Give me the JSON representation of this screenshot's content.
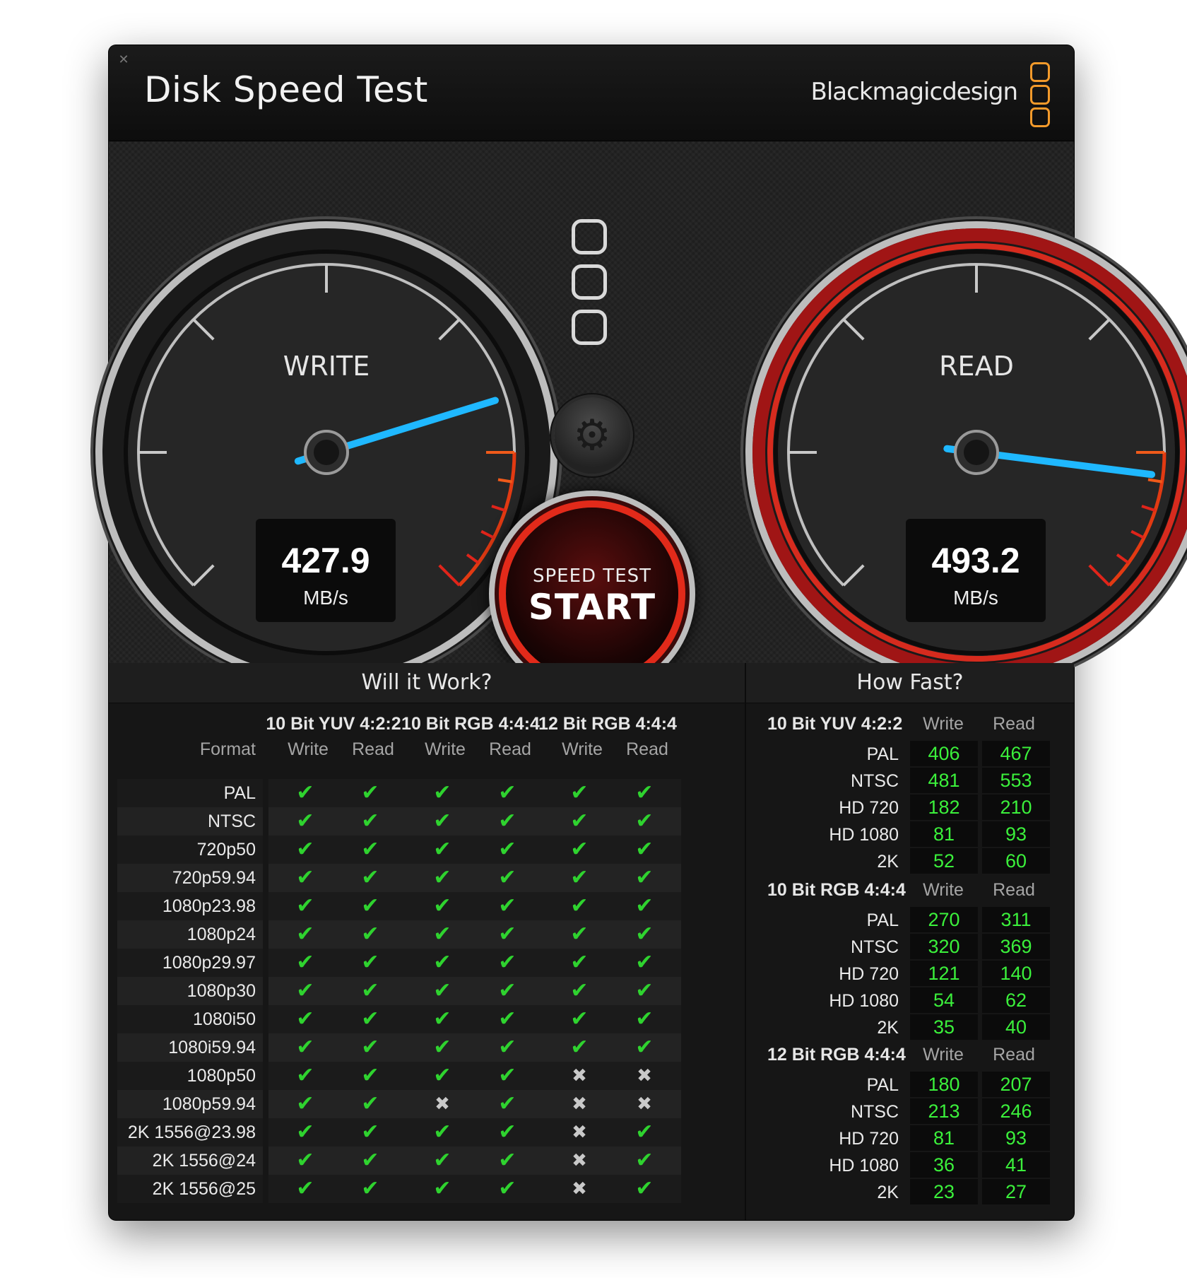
{
  "window": {
    "close_icon": "✕",
    "title": "Disk Speed Test",
    "brand": "Blackmagicdesign"
  },
  "colors": {
    "accent_orange": "#f39a2b",
    "needle_blue": "#1fb8ff",
    "start_red": "#e22a1a",
    "value_green": "#3bf03b",
    "check_green": "#2fd32f"
  },
  "gauges": {
    "write": {
      "label": "WRITE",
      "value": "427.9",
      "unit": "MB/s",
      "needle_fraction": 0.77
    },
    "read": {
      "label": "READ",
      "value": "493.2",
      "unit": "MB/s",
      "needle_fraction": 0.86
    }
  },
  "start_button": {
    "small": "SPEED TEST",
    "big": "START"
  },
  "settings_icon": "gear-icon",
  "will_it_work": {
    "title": "Will it Work?",
    "format_header": "Format",
    "groups": [
      "10 Bit YUV 4:2:2",
      "10 Bit RGB 4:4:4",
      "12 Bit RGB 4:4:4"
    ],
    "subheaders": [
      "Write",
      "Read",
      "Write",
      "Read",
      "Write",
      "Read"
    ],
    "rows": [
      {
        "format": "PAL",
        "cells": [
          1,
          1,
          1,
          1,
          1,
          1
        ]
      },
      {
        "format": "NTSC",
        "cells": [
          1,
          1,
          1,
          1,
          1,
          1
        ]
      },
      {
        "format": "720p50",
        "cells": [
          1,
          1,
          1,
          1,
          1,
          1
        ]
      },
      {
        "format": "720p59.94",
        "cells": [
          1,
          1,
          1,
          1,
          1,
          1
        ]
      },
      {
        "format": "1080p23.98",
        "cells": [
          1,
          1,
          1,
          1,
          1,
          1
        ]
      },
      {
        "format": "1080p24",
        "cells": [
          1,
          1,
          1,
          1,
          1,
          1
        ]
      },
      {
        "format": "1080p29.97",
        "cells": [
          1,
          1,
          1,
          1,
          1,
          1
        ]
      },
      {
        "format": "1080p30",
        "cells": [
          1,
          1,
          1,
          1,
          1,
          1
        ]
      },
      {
        "format": "1080i50",
        "cells": [
          1,
          1,
          1,
          1,
          1,
          1
        ]
      },
      {
        "format": "1080i59.94",
        "cells": [
          1,
          1,
          1,
          1,
          1,
          1
        ]
      },
      {
        "format": "1080p50",
        "cells": [
          1,
          1,
          1,
          1,
          0,
          0
        ]
      },
      {
        "format": "1080p59.94",
        "cells": [
          1,
          1,
          0,
          1,
          0,
          0
        ]
      },
      {
        "format": "2K 1556@23.98",
        "cells": [
          1,
          1,
          1,
          1,
          0,
          1
        ]
      },
      {
        "format": "2K 1556@24",
        "cells": [
          1,
          1,
          1,
          1,
          0,
          1
        ]
      },
      {
        "format": "2K 1556@25",
        "cells": [
          1,
          1,
          1,
          1,
          0,
          1
        ]
      }
    ]
  },
  "how_fast": {
    "title": "How Fast?",
    "write_label": "Write",
    "read_label": "Read",
    "groups": [
      {
        "name": "10 Bit YUV 4:2:2",
        "rows": [
          {
            "label": "PAL",
            "write": "406",
            "read": "467"
          },
          {
            "label": "NTSC",
            "write": "481",
            "read": "553"
          },
          {
            "label": "HD 720",
            "write": "182",
            "read": "210"
          },
          {
            "label": "HD 1080",
            "write": "81",
            "read": "93"
          },
          {
            "label": "2K",
            "write": "52",
            "read": "60"
          }
        ]
      },
      {
        "name": "10 Bit RGB 4:4:4",
        "rows": [
          {
            "label": "PAL",
            "write": "270",
            "read": "311"
          },
          {
            "label": "NTSC",
            "write": "320",
            "read": "369"
          },
          {
            "label": "HD 720",
            "write": "121",
            "read": "140"
          },
          {
            "label": "HD 1080",
            "write": "54",
            "read": "62"
          },
          {
            "label": "2K",
            "write": "35",
            "read": "40"
          }
        ]
      },
      {
        "name": "12 Bit RGB 4:4:4",
        "rows": [
          {
            "label": "PAL",
            "write": "180",
            "read": "207"
          },
          {
            "label": "NTSC",
            "write": "213",
            "read": "246"
          },
          {
            "label": "HD 720",
            "write": "81",
            "read": "93"
          },
          {
            "label": "HD 1080",
            "write": "36",
            "read": "41"
          },
          {
            "label": "2K",
            "write": "23",
            "read": "27"
          }
        ]
      }
    ]
  }
}
